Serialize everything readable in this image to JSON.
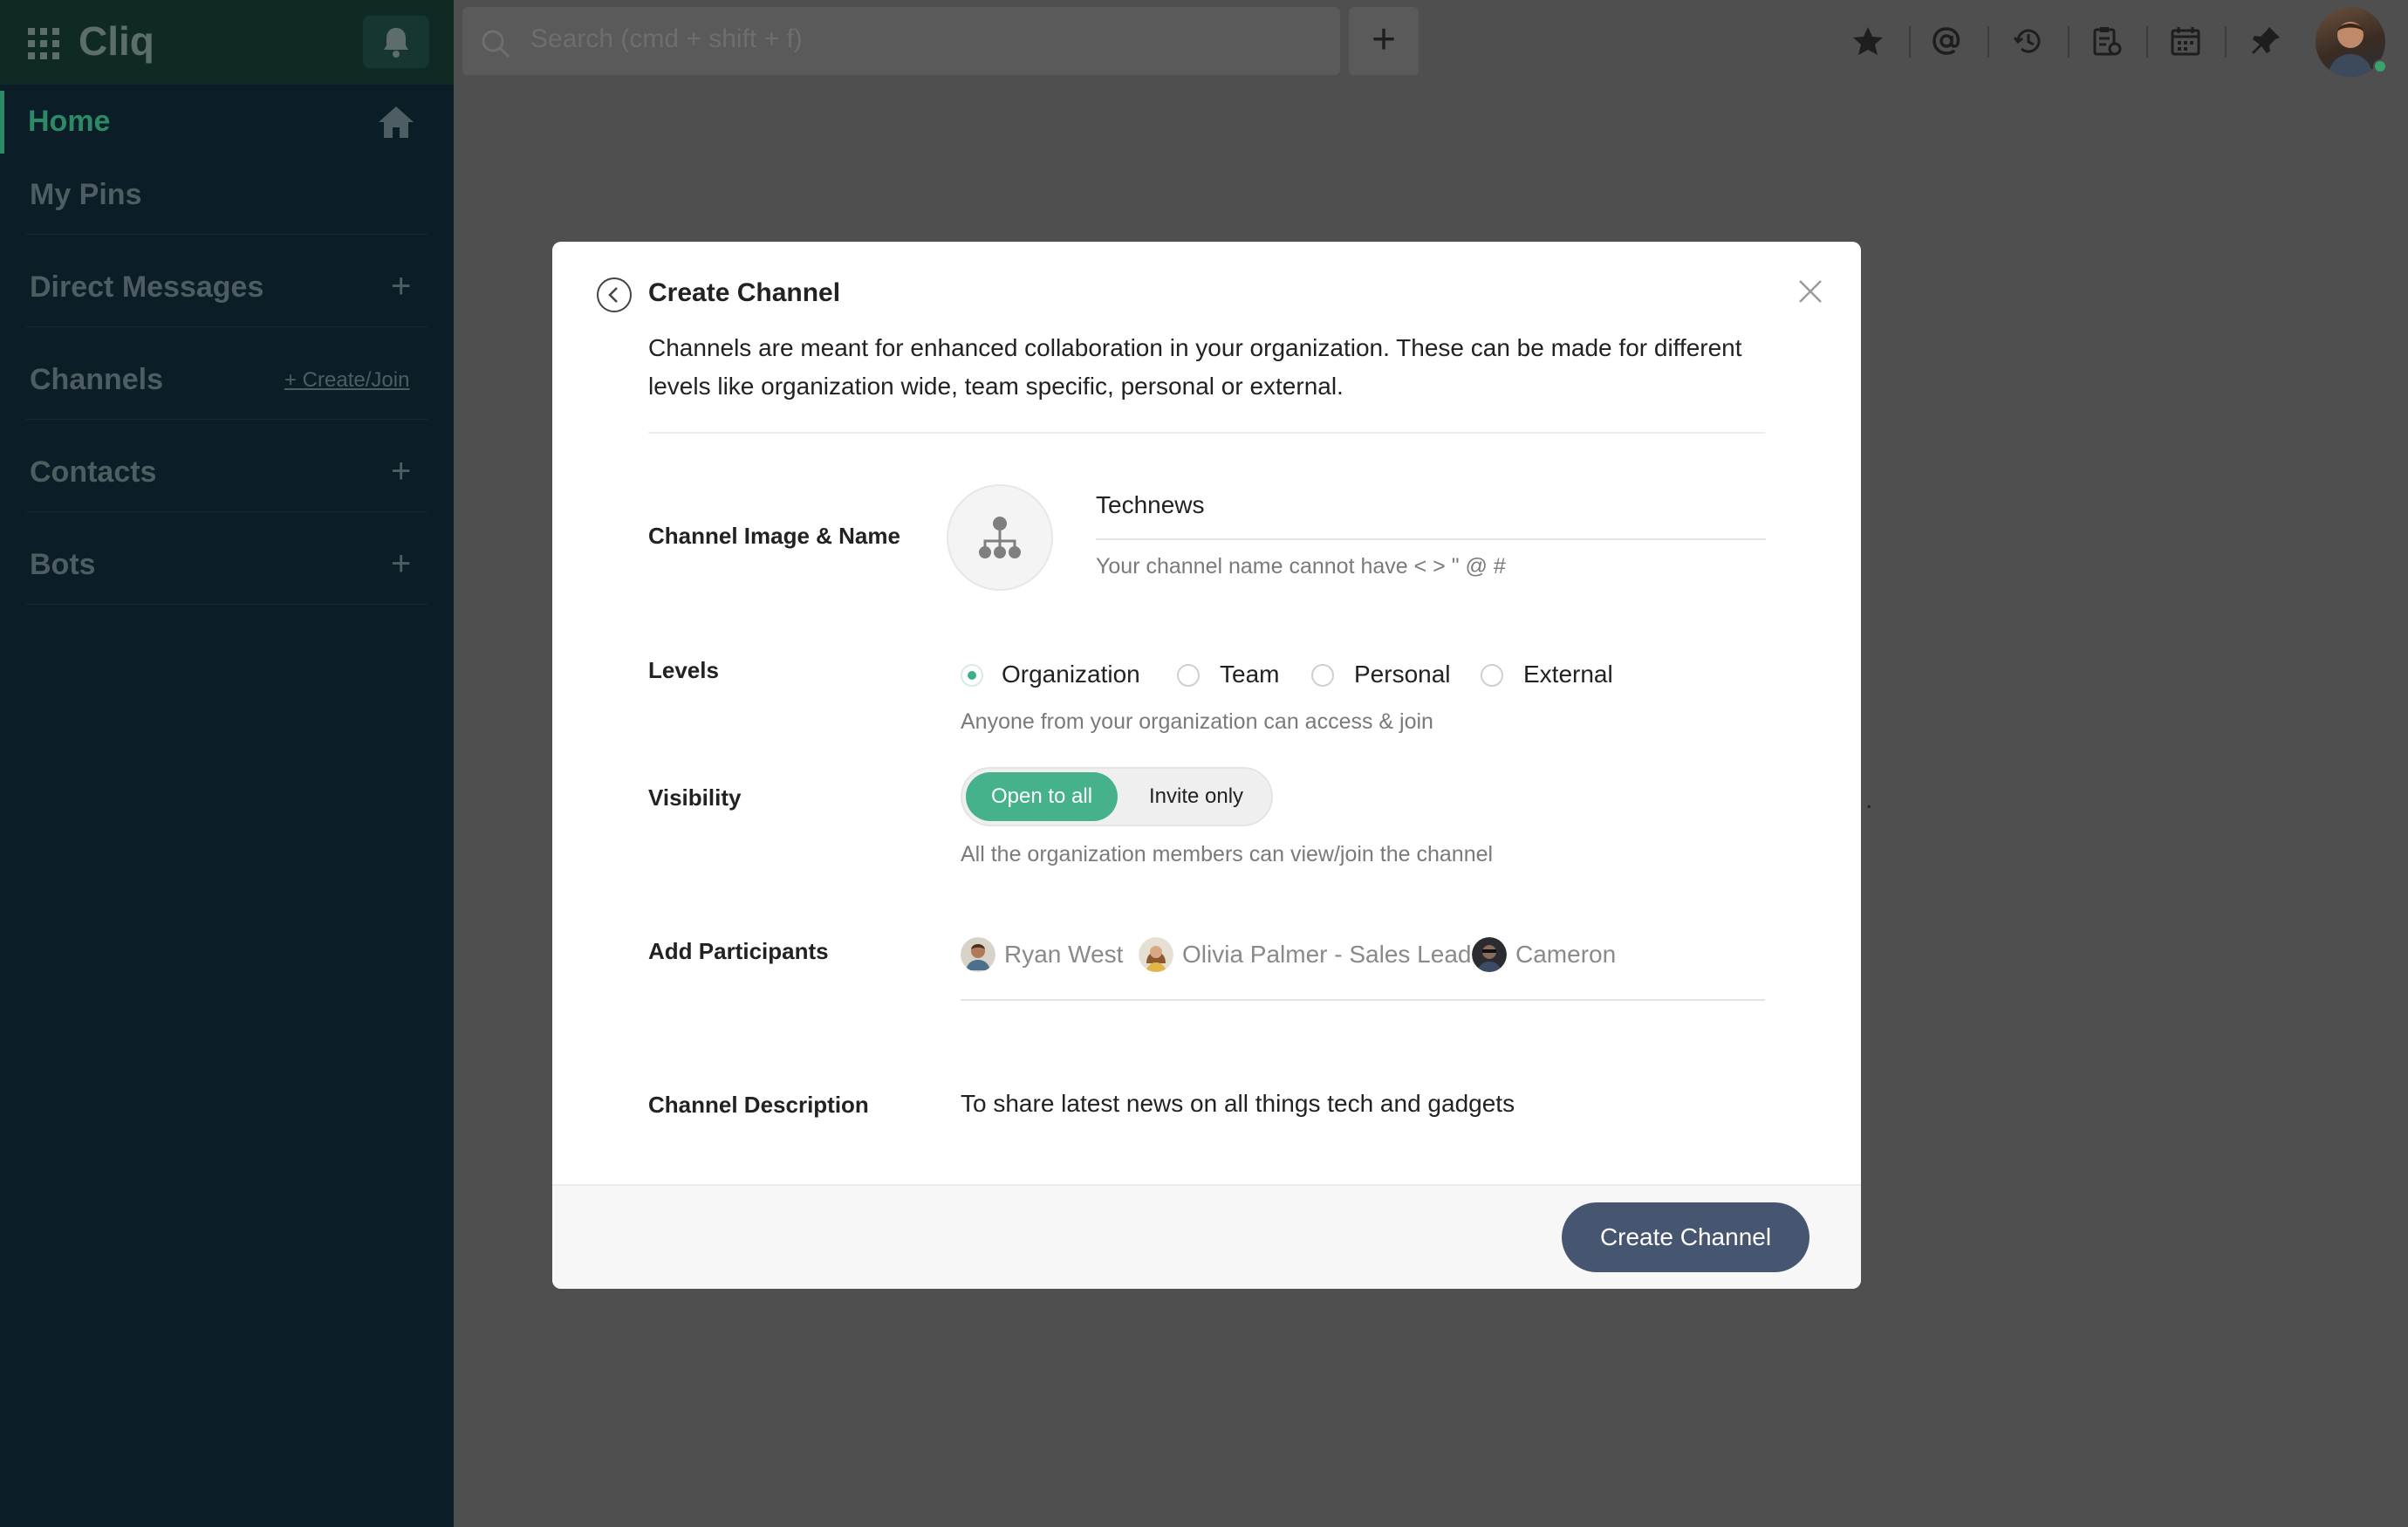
{
  "app": {
    "name": "Cliq"
  },
  "sidebar": {
    "home": "Home",
    "my_pins": "My Pins",
    "direct_messages": "Direct Messages",
    "channels": "Channels",
    "channels_action": "+ Create/Join",
    "contacts": "Contacts",
    "bots": "Bots",
    "plus": "+"
  },
  "topbar": {
    "search_placeholder": "Search (cmd + shift + f)",
    "add_label": "+",
    "icons": [
      "star-icon",
      "at-mention-icon",
      "history-icon",
      "reminders-icon",
      "calendar-icon",
      "pin-icon"
    ]
  },
  "background": {
    "trailing_text": "."
  },
  "modal": {
    "title": "Create Channel",
    "description": "Channels are meant for enhanced collaboration in your organization. These can be made for different levels like organization wide, team specific, personal or external.",
    "image_name_label": "Channel Image & Name",
    "channel_name": "Technews",
    "name_hint": "Your channel name cannot have < > \" @ #",
    "levels_label": "Levels",
    "levels": [
      {
        "label": "Organization",
        "selected": true
      },
      {
        "label": "Team",
        "selected": false
      },
      {
        "label": "Personal",
        "selected": false
      },
      {
        "label": "External",
        "selected": false
      }
    ],
    "levels_hint": "Anyone from your organization can access & join",
    "visibility_label": "Visibility",
    "visibility_options": [
      "Open to all",
      "Invite only"
    ],
    "visibility_selected": "Open to all",
    "visibility_hint": "All the organization members can view/join the channel",
    "participants_label": "Add Participants",
    "participants": [
      "Ryan West",
      "Olivia Palmer - Sales Lead",
      "Cameron"
    ],
    "channel_description_label": "Channel Description",
    "channel_description": "To share latest news on all things tech and gadgets",
    "create_button": "Create Channel"
  },
  "colors": {
    "sidebar_bg": "#0b1d26",
    "accent_green": "#3bb089",
    "primary_button": "#475670",
    "overlay": "#4f4f4f"
  }
}
